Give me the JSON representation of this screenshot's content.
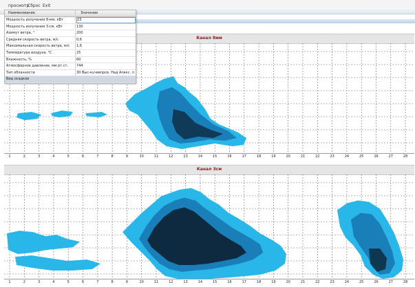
{
  "menu": {
    "items": [
      "просмотр",
      "Сброс",
      "Exit"
    ]
  },
  "left_link": "ДВ",
  "properties": {
    "header": {
      "name": "Наименование",
      "value": "Значение"
    },
    "rows": [
      {
        "name": "Мощность излучения 8-мм, кВт",
        "value": "23"
      },
      {
        "name": "Мощность излучения 3-см, кВт",
        "value": "130"
      },
      {
        "name": "Азимут ветра, °",
        "value": "200"
      },
      {
        "name": "Средняя скорость ветра, м/с",
        "value": "0,6"
      },
      {
        "name": "Максимальная скорость ветра, м/с",
        "value": "1,6"
      },
      {
        "name": "Температура воздуха, °С",
        "value": "25"
      },
      {
        "name": "Влажность, %",
        "value": "60"
      },
      {
        "name": "Атмосферное давление, мм рт.ст.",
        "value": "744"
      },
      {
        "name": "Тип облачности",
        "value": "30 Выс-кучевпрсв. Над Алекс. прсв"
      },
      {
        "name": "Вид осадков",
        "value": ""
      }
    ]
  },
  "panels": [
    {
      "title": "Канал 8мм"
    },
    {
      "title": "Канал 3см"
    }
  ],
  "axis_ticks": [
    "1",
    "2",
    "3",
    "4",
    "5",
    "6",
    "7",
    "8",
    "9",
    "10",
    "11",
    "12",
    "13",
    "14",
    "15",
    "16",
    "17",
    "18",
    "19",
    "20",
    "21",
    "22",
    "23",
    "24",
    "25",
    "26",
    "27",
    "28",
    "29"
  ],
  "colors": {
    "echo_light": "#29b6e8",
    "echo_mid": "#1a7fb8",
    "echo_dark": "#0d2a40",
    "grid": "#6f6f6f",
    "title_text": "#8c1b1b"
  }
}
